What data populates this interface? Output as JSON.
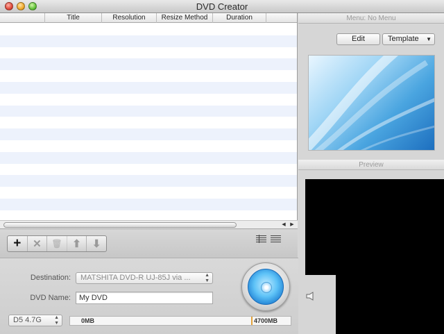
{
  "window": {
    "title": "DVD Creator"
  },
  "list": {
    "columns": [
      "",
      "Title",
      "Resolution",
      "Resize Method",
      "Duration"
    ],
    "row_count": 17
  },
  "toolbar": {
    "add_label": "+",
    "remove_label": "✕",
    "delete_label": "🗑",
    "up_label": "⬆",
    "down_label": "⬇"
  },
  "settings": {
    "destination_label": "Destination:",
    "destination_value": "MATSHITA DVD-R   UJ-85J via ...",
    "dvd_name_label": "DVD Name:",
    "dvd_name_value": "My DVD",
    "disc_type": "D5 4.7G"
  },
  "capacity": {
    "used_label": "0MB",
    "total_label": "4700MB",
    "used_fraction": 0
  },
  "menu_panel": {
    "title": "Menu: No Menu",
    "edit_label": "Edit",
    "template_label": "Template"
  },
  "preview_panel": {
    "title": "Preview"
  },
  "colors": {
    "row_stripe": "#edf2fc",
    "burn_blue": "#1e7fd2",
    "capacity_marker": "#e3a23a"
  },
  "icons": [
    "close-traffic-light",
    "minimize-traffic-light",
    "zoom-traffic-light",
    "plus-icon",
    "x-icon",
    "trash-icon",
    "arrow-up-icon",
    "arrow-down-icon",
    "list-view-icon",
    "detail-view-icon",
    "burn-disc-icon",
    "volume-icon"
  ]
}
